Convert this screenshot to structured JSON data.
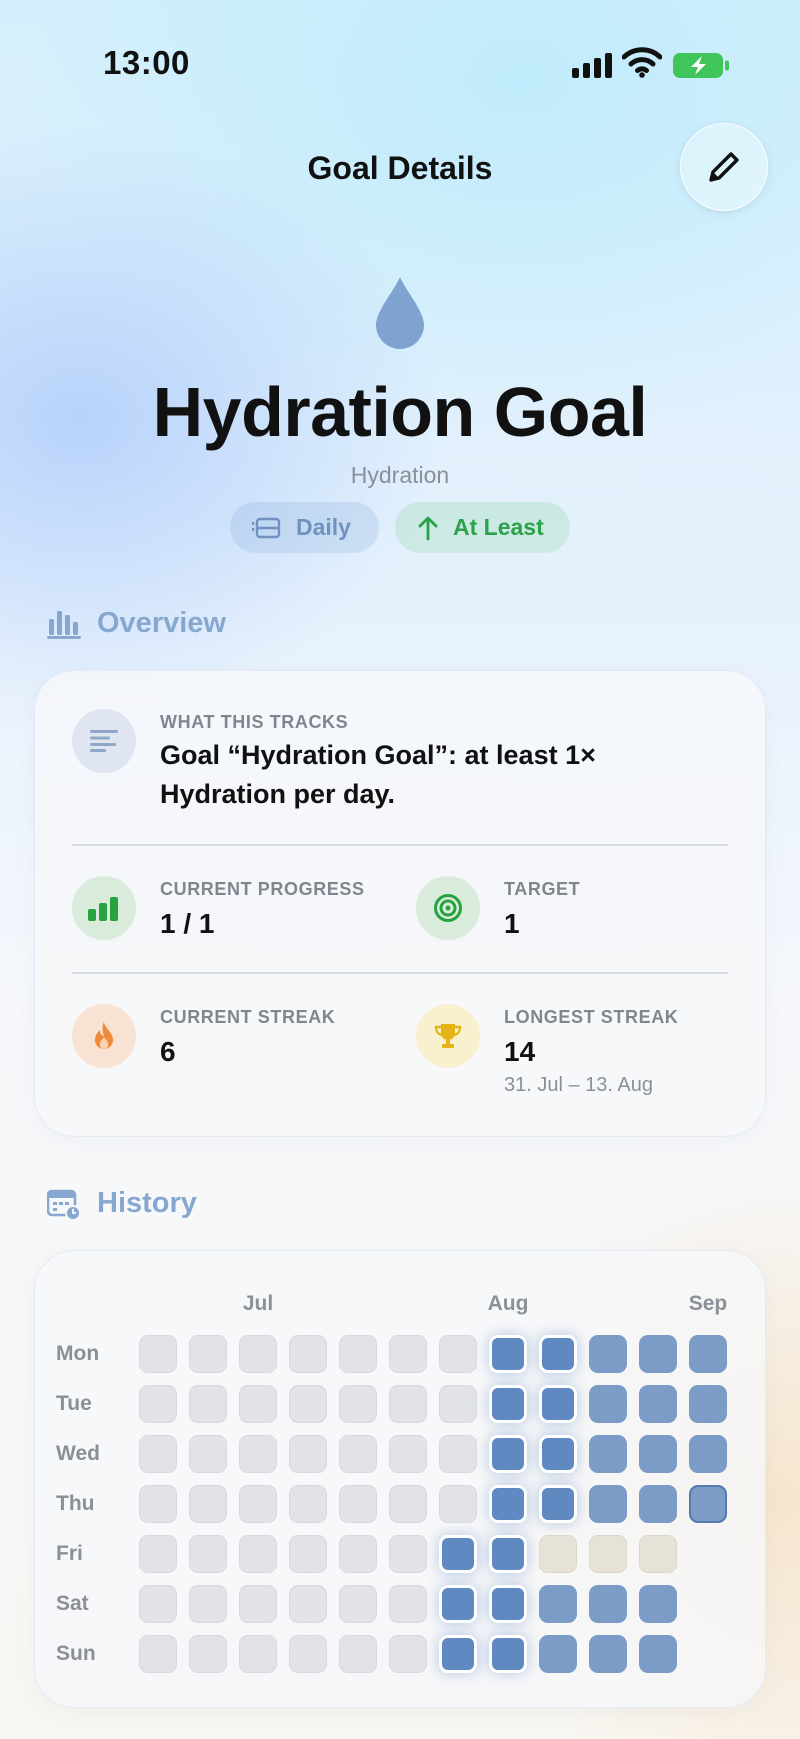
{
  "status_bar": {
    "time": "13:00",
    "battery_charging": true,
    "battery_color": "#3fc55a"
  },
  "header": {
    "title": "Goal Details",
    "edit_icon": "pencil-icon"
  },
  "goal": {
    "icon": "water-drop-icon",
    "title": "Hydration Goal",
    "category": "Hydration",
    "chips": {
      "frequency": "Daily",
      "direction": "At Least"
    }
  },
  "overview": {
    "heading": "Overview",
    "what_label": "WHAT THIS TRACKS",
    "what_lines": [
      "Goal “Hydration Goal”: at least 1×",
      "Hydration per day."
    ],
    "stats": {
      "progress_label": "CURRENT PROGRESS",
      "progress_value": "1 / 1",
      "target_label": "TARGET",
      "target_value": "1",
      "streak_label": "CURRENT STREAK",
      "streak_value": "6",
      "longest_label": "LONGEST STREAK",
      "longest_value": "14",
      "longest_range": "31. Jul – 13. Aug"
    }
  },
  "history": {
    "heading": "History",
    "months": [
      {
        "label": "Jul",
        "week": 2
      },
      {
        "label": "Aug",
        "week": 7
      },
      {
        "label": "Sep",
        "week": 11
      }
    ],
    "days": [
      "Mon",
      "Tue",
      "Wed",
      "Thu",
      "Fri",
      "Sat",
      "Sun"
    ],
    "legend_colors": {
      "empty": "#e1e3e7",
      "done": "#7a9cc7",
      "highlight": "#5f89c0",
      "missed": "#e6e2d8"
    },
    "grid": [
      [
        "empty",
        "empty",
        "empty",
        "empty",
        "empty",
        "empty",
        "empty",
        "hi",
        "hi",
        "done",
        "done",
        "done"
      ],
      [
        "empty",
        "empty",
        "empty",
        "empty",
        "empty",
        "empty",
        "empty",
        "hi",
        "hi",
        "done",
        "done",
        "done"
      ],
      [
        "empty",
        "empty",
        "empty",
        "empty",
        "empty",
        "empty",
        "empty",
        "hi",
        "hi",
        "done",
        "done",
        "done"
      ],
      [
        "empty",
        "empty",
        "empty",
        "empty",
        "empty",
        "empty",
        "empty",
        "hi",
        "hi",
        "done",
        "done",
        "today"
      ],
      [
        "empty",
        "empty",
        "empty",
        "empty",
        "empty",
        "empty",
        "hi",
        "hi",
        "miss",
        "miss",
        "miss",
        "none"
      ],
      [
        "empty",
        "empty",
        "empty",
        "empty",
        "empty",
        "empty",
        "hi",
        "hi",
        "done",
        "done",
        "done",
        "none"
      ],
      [
        "empty",
        "empty",
        "empty",
        "empty",
        "empty",
        "empty",
        "hi",
        "hi",
        "done",
        "done",
        "done",
        "none"
      ]
    ]
  }
}
